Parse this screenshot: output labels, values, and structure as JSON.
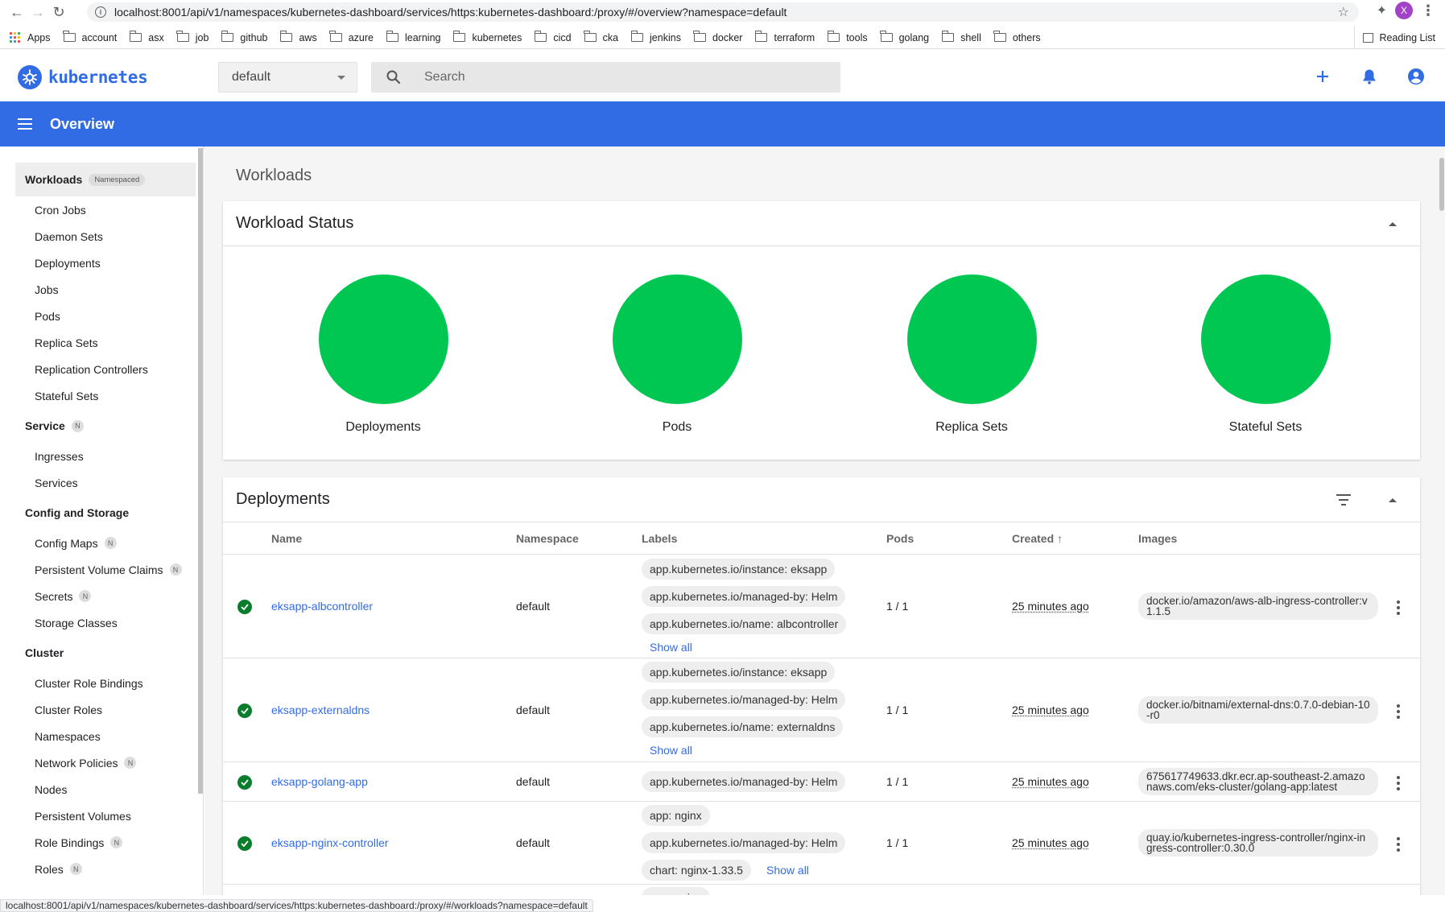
{
  "browser": {
    "url": "localhost:8001/api/v1/namespaces/kubernetes-dashboard/services/https:kubernetes-dashboard:/proxy/#/overview?namespace=default",
    "profile_initial": "X",
    "bookmarks": [
      "Apps",
      "account",
      "asx",
      "job",
      "github",
      "aws",
      "azure",
      "learning",
      "kubernetes",
      "cicd",
      "cka",
      "jenkins",
      "docker",
      "terraform",
      "tools",
      "golang",
      "shell",
      "others"
    ],
    "reading_list": "Reading List",
    "status_url": "localhost:8001/api/v1/namespaces/kubernetes-dashboard/services/https:kubernetes-dashboard:/proxy/#/workloads?namespace=default"
  },
  "app": {
    "logo_text": "kubernetes",
    "namespace": "default",
    "search_placeholder": "Search",
    "header_title": "Overview",
    "brand_color": "#326ce5"
  },
  "sidebar": {
    "sections": [
      {
        "title": "Workloads",
        "badge": "Namespaced",
        "items": [
          {
            "label": "Cron Jobs"
          },
          {
            "label": "Daemon Sets"
          },
          {
            "label": "Deployments"
          },
          {
            "label": "Jobs"
          },
          {
            "label": "Pods"
          },
          {
            "label": "Replica Sets"
          },
          {
            "label": "Replication Controllers"
          },
          {
            "label": "Stateful Sets"
          }
        ]
      },
      {
        "title": "Service",
        "badge": "N",
        "items": [
          {
            "label": "Ingresses"
          },
          {
            "label": "Services"
          }
        ]
      },
      {
        "title": "Config and Storage",
        "badge": "",
        "items": [
          {
            "label": "Config Maps",
            "badge": "N"
          },
          {
            "label": "Persistent Volume Claims",
            "badge": "N"
          },
          {
            "label": "Secrets",
            "badge": "N"
          },
          {
            "label": "Storage Classes"
          }
        ]
      },
      {
        "title": "Cluster",
        "badge": "",
        "items": [
          {
            "label": "Cluster Role Bindings"
          },
          {
            "label": "Cluster Roles"
          },
          {
            "label": "Namespaces"
          },
          {
            "label": "Network Policies",
            "badge": "N"
          },
          {
            "label": "Nodes"
          },
          {
            "label": "Persistent Volumes"
          },
          {
            "label": "Role Bindings",
            "badge": "N"
          },
          {
            "label": "Roles",
            "badge": "N"
          }
        ]
      }
    ]
  },
  "main": {
    "section_title": "Workloads",
    "workload_status": {
      "title": "Workload Status",
      "items": [
        "Deployments",
        "Pods",
        "Replica Sets",
        "Stateful Sets"
      ],
      "status_color": "#00c752"
    },
    "deployments": {
      "title": "Deployments",
      "columns": {
        "name": "Name",
        "namespace": "Namespace",
        "labels": "Labels",
        "pods": "Pods",
        "created": "Created",
        "images": "Images"
      },
      "rows": [
        {
          "name": "eksapp-albcontroller",
          "namespace": "default",
          "labels": [
            "app.kubernetes.io/instance: eksapp",
            "app.kubernetes.io/managed-by: Helm",
            "app.kubernetes.io/name: albcontroller"
          ],
          "show_all": "Show all",
          "pods": "1 / 1",
          "created": "25 minutes ago",
          "image": "docker.io/amazon/aws-alb-ingress-controller:v1.1.5"
        },
        {
          "name": "eksapp-externaldns",
          "namespace": "default",
          "labels": [
            "app.kubernetes.io/instance: eksapp",
            "app.kubernetes.io/managed-by: Helm",
            "app.kubernetes.io/name: externaldns"
          ],
          "show_all": "Show all",
          "pods": "1 / 1",
          "created": "25 minutes ago",
          "image": "docker.io/bitnami/external-dns:0.7.0-debian-10-r0"
        },
        {
          "name": "eksapp-golang-app",
          "namespace": "default",
          "labels": [
            "app.kubernetes.io/managed-by: Helm"
          ],
          "show_all": "",
          "pods": "1 / 1",
          "created": "25 minutes ago",
          "image": "675617749633.dkr.ecr.ap-southeast-2.amazonaws.com/eks-cluster/golang-app:latest"
        },
        {
          "name": "eksapp-nginx-controller",
          "namespace": "default",
          "labels": [
            "app: nginx",
            "app.kubernetes.io/managed-by: Helm",
            "chart: nginx-1.33.5"
          ],
          "show_all": "Show all",
          "pods": "1 / 1",
          "created": "25 minutes ago",
          "image": "quay.io/kubernetes-ingress-controller/nginx-ingress-controller:0.30.0"
        }
      ],
      "partial_row_label": "app: nginx"
    }
  }
}
